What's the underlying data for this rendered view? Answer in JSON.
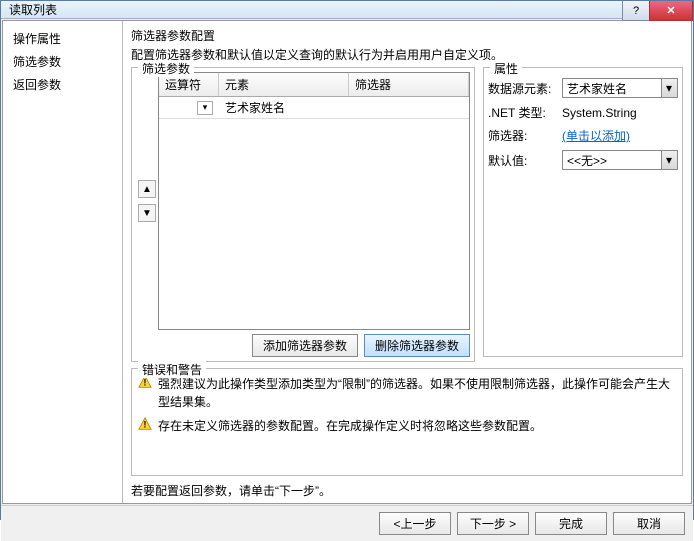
{
  "window": {
    "title": "读取列表"
  },
  "sidebar": {
    "items": [
      {
        "label": "操作属性"
      },
      {
        "label": "筛选参数"
      },
      {
        "label": "返回参数"
      }
    ]
  },
  "section": {
    "title": "筛选器参数配置",
    "desc": "配置筛选器参数和默认值以定义查询的默认行为并启用用户自定义项。"
  },
  "filter": {
    "legend": "筛选参数",
    "headers": {
      "operator": "运算符",
      "element": "元素",
      "filter": "筛选器"
    },
    "rows": [
      {
        "operator": "",
        "element": "艺术家姓名",
        "filter": ""
      }
    ],
    "add_btn": "添加筛选器参数",
    "del_btn": "删除筛选器参数"
  },
  "props": {
    "legend": "属性",
    "labels": {
      "source": "数据源元素:",
      "nettype": ".NET 类型:",
      "filter": "筛选器:",
      "default": "默认值:"
    },
    "values": {
      "source": "艺术家姓名",
      "nettype": "System.String",
      "filter_link": "(单击以添加)",
      "default": "<<无>>"
    }
  },
  "errors": {
    "legend": "错误和警告",
    "items": [
      "强烈建议为此操作类型添加类型为“限制”的筛选器。如果不使用限制筛选器，此操作可能会产生大型结果集。",
      "存在未定义筛选器的参数配置。在完成操作定义时将忽略这些参数配置。"
    ]
  },
  "footer_note": "若要配置返回参数，请单击“下一步”。",
  "buttons": {
    "back": "<上一步",
    "next": "下一步 >",
    "finish": "完成",
    "cancel": "取消"
  }
}
